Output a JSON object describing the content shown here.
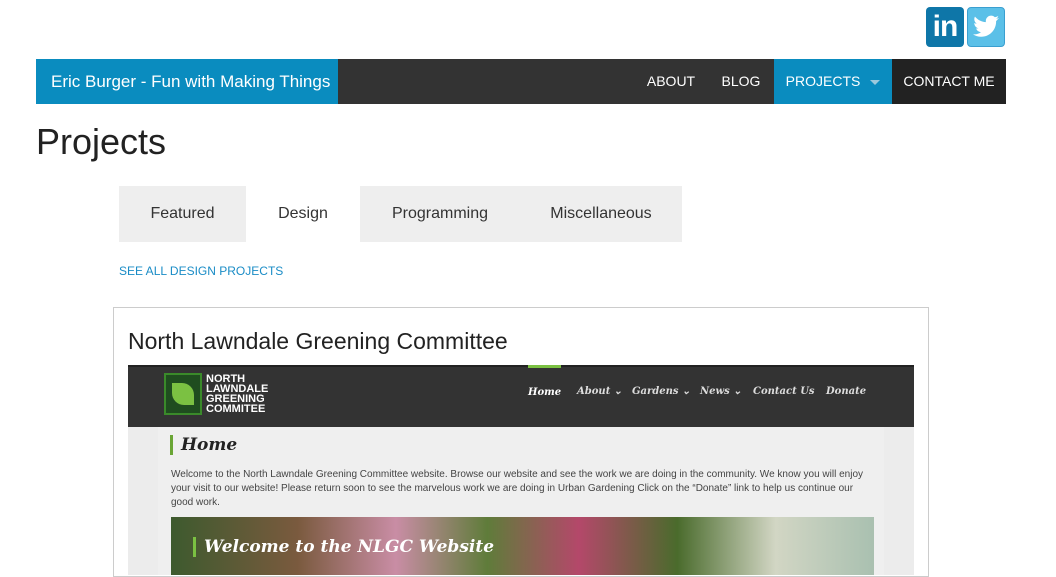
{
  "social": {
    "linkedin_label": "in",
    "twitter_icon": "twitter-bird-icon"
  },
  "header": {
    "brand": "Eric Burger - Fun with Making Things",
    "nav": [
      "ABOUT",
      "BLOG",
      "PROJECTS",
      "CONTACT ME"
    ],
    "active_nav": "PROJECTS"
  },
  "page": {
    "title": "Projects"
  },
  "tabs": {
    "items": [
      "Featured",
      "Design",
      "Programming",
      "Miscellaneous"
    ],
    "active": "Design"
  },
  "see_all_link": "SEE ALL DESIGN PROJECTS",
  "project": {
    "title": "North Lawndale Greening Committee",
    "screenshot": {
      "logo_text": "NORTH LAWNDALE GREENING COMMITEE",
      "nav": [
        "Home",
        "About ⌄",
        "Gardens ⌄",
        "News ⌄",
        "Contact Us",
        "Donate"
      ],
      "heading": "Home",
      "paragraph": "Welcome to the North Lawndale Greening Committee website. Browse our website and see the work we are doing in the community. We know you will enjoy your visit to our website! Please return soon to see the marvelous work we are doing in Urban Gardening  Click on the “Donate” link to help us continue our good work.",
      "banner": "Welcome to the NLGC Website"
    }
  },
  "colors": {
    "accent": "#0a8cbf",
    "bar": "#333333",
    "link": "#1a8cc6",
    "green": "#7bc142"
  }
}
